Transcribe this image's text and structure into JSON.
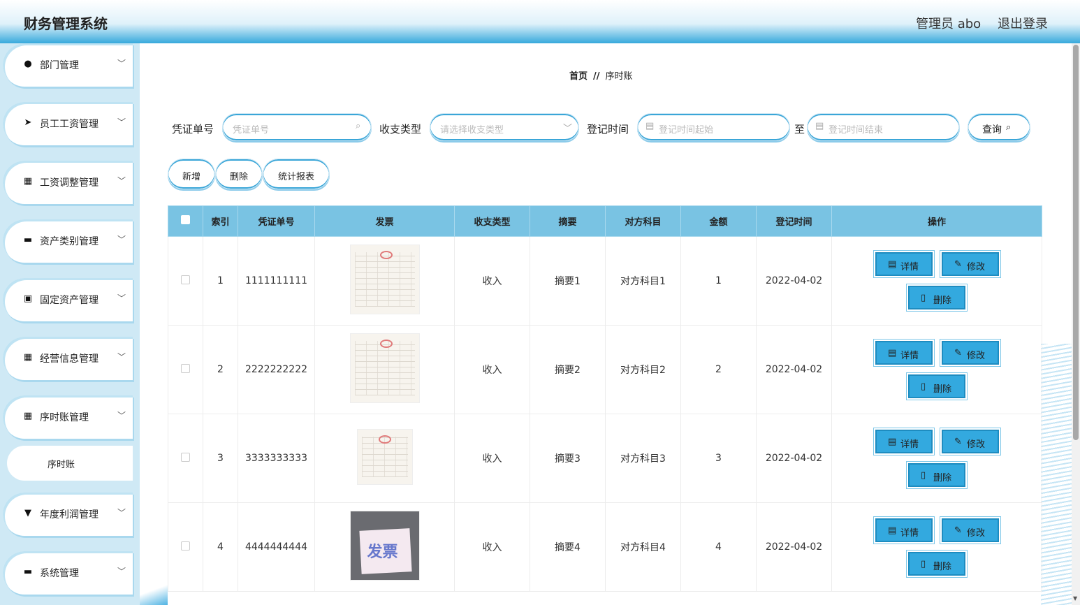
{
  "header": {
    "title": "财务管理系统",
    "user": "管理员 abo",
    "logout": "退出登录"
  },
  "sidebar": {
    "items": [
      {
        "label": "部门管理",
        "icon": "lightbulb-icon",
        "glyph": "●"
      },
      {
        "label": "员工工资管理",
        "icon": "send-icon",
        "glyph": "➤"
      },
      {
        "label": "工资调整管理",
        "icon": "grid-icon",
        "glyph": "▦"
      },
      {
        "label": "资产类别管理",
        "icon": "comment-icon",
        "glyph": "▬"
      },
      {
        "label": "固定资产管理",
        "icon": "clipboard-icon",
        "glyph": "▣"
      },
      {
        "label": "经营信息管理",
        "icon": "grid-icon",
        "glyph": "▦"
      },
      {
        "label": "序时账管理",
        "icon": "grid-icon",
        "glyph": "▦"
      },
      {
        "label": "年度利润管理",
        "icon": "trophy-icon",
        "glyph": "▼"
      },
      {
        "label": "系统管理",
        "icon": "briefcase-icon",
        "glyph": "▬"
      }
    ],
    "sub_item": "序时账"
  },
  "breadcrumb": {
    "home": "首页",
    "sep": "//",
    "current": "序时账"
  },
  "search": {
    "voucher_label": "凭证单号",
    "voucher_placeholder": "凭证单号",
    "type_label": "收支类型",
    "type_placeholder": "请选择收支类型",
    "time_label": "登记时间",
    "time_start_placeholder": "登记时间起始",
    "to": "至",
    "time_end_placeholder": "登记时间结束",
    "query": "查询"
  },
  "actions": {
    "add": "新增",
    "delete": "删除",
    "report": "统计报表"
  },
  "table": {
    "headers": [
      "索引",
      "凭证单号",
      "发票",
      "收支类型",
      "摘要",
      "对方科目",
      "金额",
      "登记时间",
      "操作"
    ],
    "rows": [
      {
        "index": "1",
        "voucher": "1111111111",
        "type": "收入",
        "summary": "摘要1",
        "account": "对方科目1",
        "amount": "1",
        "date": "2022-04-02"
      },
      {
        "index": "2",
        "voucher": "2222222222",
        "type": "收入",
        "summary": "摘要2",
        "account": "对方科目2",
        "amount": "2",
        "date": "2022-04-02"
      },
      {
        "index": "3",
        "voucher": "3333333333",
        "type": "收入",
        "summary": "摘要3",
        "account": "对方科目3",
        "amount": "3",
        "date": "2022-04-02"
      },
      {
        "index": "4",
        "voucher": "4444444444",
        "type": "收入",
        "summary": "摘要4",
        "account": "对方科目4",
        "amount": "4",
        "date": "2022-04-02"
      }
    ],
    "op_detail": "详情",
    "op_edit": "修改",
    "op_delete": "删除",
    "photo_text": "发票"
  },
  "colors": {
    "accent": "#33a9df",
    "header_bg": "#79c3e3"
  }
}
